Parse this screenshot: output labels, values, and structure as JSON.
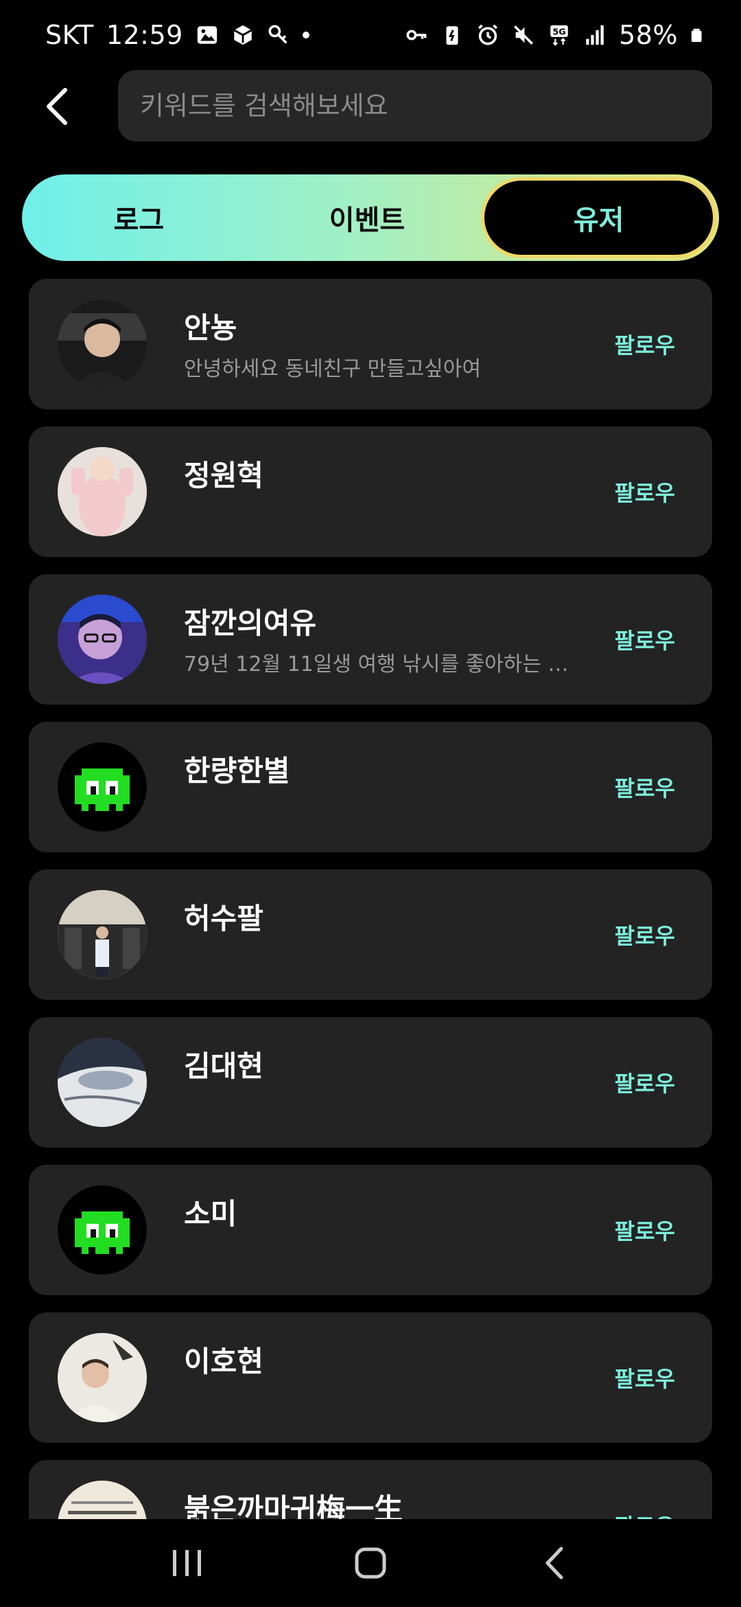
{
  "status_bar": {
    "carrier": "SKT",
    "time": "12:59",
    "battery": "58%",
    "network": "5G"
  },
  "search": {
    "placeholder": "키워드를 검색해보세요",
    "value": ""
  },
  "tabs": [
    {
      "label": "로그",
      "active": false
    },
    {
      "label": "이벤트",
      "active": false
    },
    {
      "label": "유저",
      "active": true
    }
  ],
  "users": [
    {
      "name": "안뇽",
      "bio": "안녕하세요 동네친구 만들고싶아여",
      "follow_label": "팔로우",
      "avatar": "photo-person"
    },
    {
      "name": "정원혁",
      "bio": "",
      "follow_label": "팔로우",
      "avatar": "photo-baby"
    },
    {
      "name": "잠깐의여유",
      "bio": "79년 12월 11일생 여행 낚시를 좋아하는 미...",
      "follow_label": "팔로우",
      "avatar": "photo-selfie"
    },
    {
      "name": "한량한별",
      "bio": "",
      "follow_label": "팔로우",
      "avatar": "green-invader"
    },
    {
      "name": "허수팔",
      "bio": "",
      "follow_label": "팔로우",
      "avatar": "photo-store"
    },
    {
      "name": "김대현",
      "bio": "",
      "follow_label": "팔로우",
      "avatar": "photo-car"
    },
    {
      "name": "소미",
      "bio": "",
      "follow_label": "팔로우",
      "avatar": "green-invader"
    },
    {
      "name": "이호현",
      "bio": "",
      "follow_label": "팔로우",
      "avatar": "photo-office"
    },
    {
      "name": "붉은까마귀梅一生",
      "bio": "",
      "follow_label": "팔로우",
      "avatar": "photo-paper"
    }
  ],
  "colors": {
    "accent": "#7ef0dc",
    "card_bg": "#232323",
    "tab_gradient_start": "#6ff0ea",
    "tab_gradient_end": "#e3e57a",
    "active_tab_border": "#efd86a"
  }
}
